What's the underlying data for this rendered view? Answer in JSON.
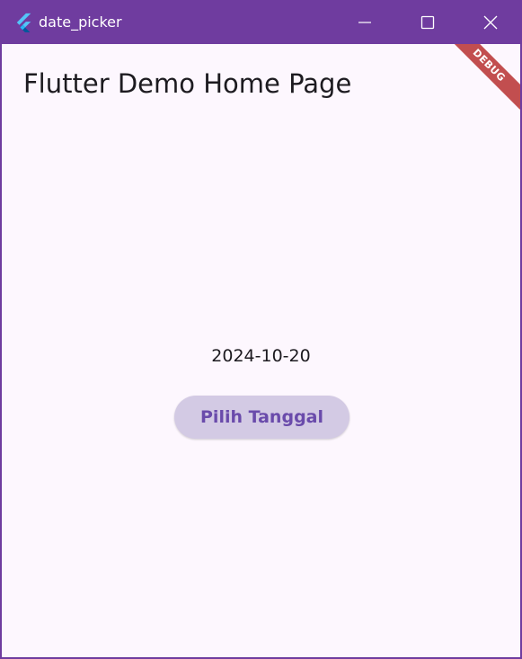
{
  "window": {
    "title": "date_picker",
    "app_icon": "flutter-logo-icon",
    "controls": {
      "minimize_icon": "minimize-icon",
      "maximize_icon": "maximize-icon",
      "close_icon": "close-icon"
    }
  },
  "appbar": {
    "title": "Flutter Demo Home Page"
  },
  "body": {
    "selected_date": "2024-10-20",
    "pick_date_button_label": "Pilih Tanggal"
  },
  "debug_banner": {
    "label": "DEBUG"
  },
  "colors": {
    "titlebar": "#6f3c9f",
    "background": "#fdf7fe",
    "button_bg": "#d3cae4",
    "button_text": "#6a4bab",
    "debug_banner": "#b42828"
  }
}
